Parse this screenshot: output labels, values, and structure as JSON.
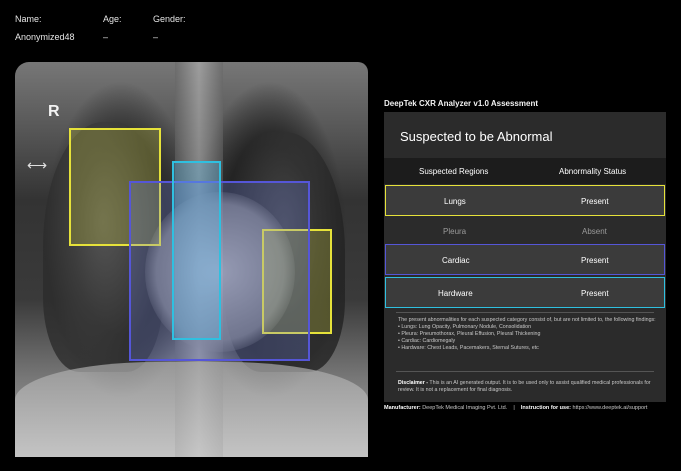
{
  "patient": {
    "name_label": "Name:",
    "name_value": "Anonymized48",
    "age_label": "Age:",
    "age_value": "–",
    "gender_label": "Gender:",
    "gender_value": "–"
  },
  "image": {
    "side_marker": "R",
    "arrow_marker": "⟷"
  },
  "report": {
    "app_title": "DeepTek CXR Analyzer v1.0 Assessment",
    "heading": "Suspected to be Abnormal",
    "col_region": "Suspected Regions",
    "col_status": "Abnormality Status",
    "rows": [
      {
        "region": "Lungs",
        "status": "Present"
      },
      {
        "region": "Pleura",
        "status": "Absent"
      },
      {
        "region": "Cardiac",
        "status": "Present"
      },
      {
        "region": "Hardware",
        "status": "Present"
      }
    ],
    "notes_intro": "The present abnormalities for each suspected category consist of, but are not limited to, the following findings:",
    "notes": [
      "• Lungs: Lung Opacity, Pulmonary Nodule, Consolidation",
      "• Pleura: Pneumothorax, Pleural Effusion, Pleural Thickening",
      "• Cardiac: Cardiomegaly",
      "• Hardware: Chest Leads, Pacemakers, Sternal Sutures, etc"
    ],
    "disclaimer_label": "Disclaimer -",
    "disclaimer_text": " This is an AI generated output. It is to be used only to assist qualified medical professionals for review. It is not a replacement for final diagnosis."
  },
  "footer": {
    "manufacturer_label": "Manufacturer:",
    "manufacturer_value": " DeepTek Medical Imaging Pvt. Ltd.",
    "divider": "|",
    "instruction_label": "Instruction for use:",
    "instruction_value": " https://www.deeptek.ai/support"
  },
  "colors": {
    "lungs_box": "#e6e23a",
    "cardiac_box": "#5556d8",
    "hardware_box": "#2fc0e0"
  }
}
